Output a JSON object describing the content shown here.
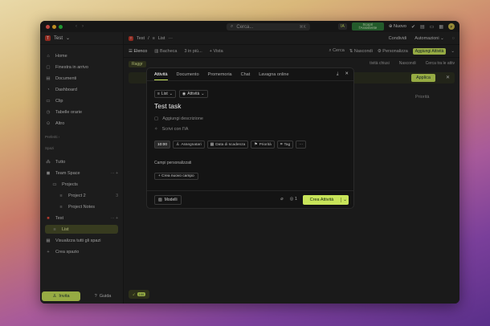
{
  "titlebar": {
    "search_label": "Cerca...",
    "search_shortcut": "⌘K",
    "ia_label": "IA",
    "green_chip": "Scopri l'Assistente",
    "new_label": "Nuovo",
    "avatar_initial": "F"
  },
  "sidebar": {
    "workspace_initial": "T",
    "workspace_name": "Test",
    "items": [
      {
        "label": "Home",
        "icon": "home-icon"
      },
      {
        "label": "Finestra in arrivo",
        "icon": "inbox-icon"
      },
      {
        "label": "Documenti",
        "icon": "docs-icon"
      },
      {
        "label": "Dashboard",
        "icon": "dashboard-icon"
      },
      {
        "label": "Clip",
        "icon": "clip-icon"
      },
      {
        "label": "Tabelle orarie",
        "icon": "clock-icon"
      },
      {
        "label": "Altro",
        "icon": "more-icon"
      }
    ],
    "favorites_label": "Preferiti",
    "spaces_label": "Spazi",
    "spaces": [
      {
        "label": "Tutto"
      },
      {
        "label": "Team Space"
      },
      {
        "label": "Projects"
      },
      {
        "label": "Project 2",
        "count": "3"
      },
      {
        "label": "Project Notes"
      },
      {
        "label": "Test"
      },
      {
        "label": "List"
      },
      {
        "label": "Visualizza tutti gli spazi"
      },
      {
        "label": "Crea spazio"
      }
    ],
    "invite_label": "Invita",
    "help_label": "Guida"
  },
  "main": {
    "breadcrumb_ws": "Test",
    "breadcrumb_list": "List",
    "share_label": "Condividi",
    "automations_label": "Automazioni",
    "views": [
      "Elenco",
      "Bacheca",
      "3 in più...",
      "+ Vista"
    ],
    "search_label": "Cerca",
    "hide_label": "Nascondi",
    "customize_label": "Personalizza",
    "add_task_label": "Aggiungi Attività",
    "group_chip": "Raggr",
    "filter_right": [
      "tività chiusi",
      "Nascondi",
      "Cerca tra le attiv"
    ],
    "apply_label": "Applica",
    "col_name": "N",
    "col_priority": "Priorità",
    "bottom_count": "100"
  },
  "modal": {
    "tabs": [
      "Attività",
      "Documento",
      "Promemoria",
      "Chat",
      "Lavagna online"
    ],
    "chip_list": "List",
    "chip_type": "Attività",
    "task_title": "Test task",
    "add_description": "Aggiungi descrizione",
    "write_ai": "Scrivi con l'IA",
    "time": "10:00",
    "props": [
      "Assegnatari",
      "Data di scadenza",
      "Priorità",
      "Tag",
      "···"
    ],
    "custom_fields_label": "Campi personalizzati",
    "new_field_label": "+ Crea nuovo campo",
    "models_label": "Modelli",
    "notify_count": "1",
    "create_label": "Crea Attività"
  }
}
